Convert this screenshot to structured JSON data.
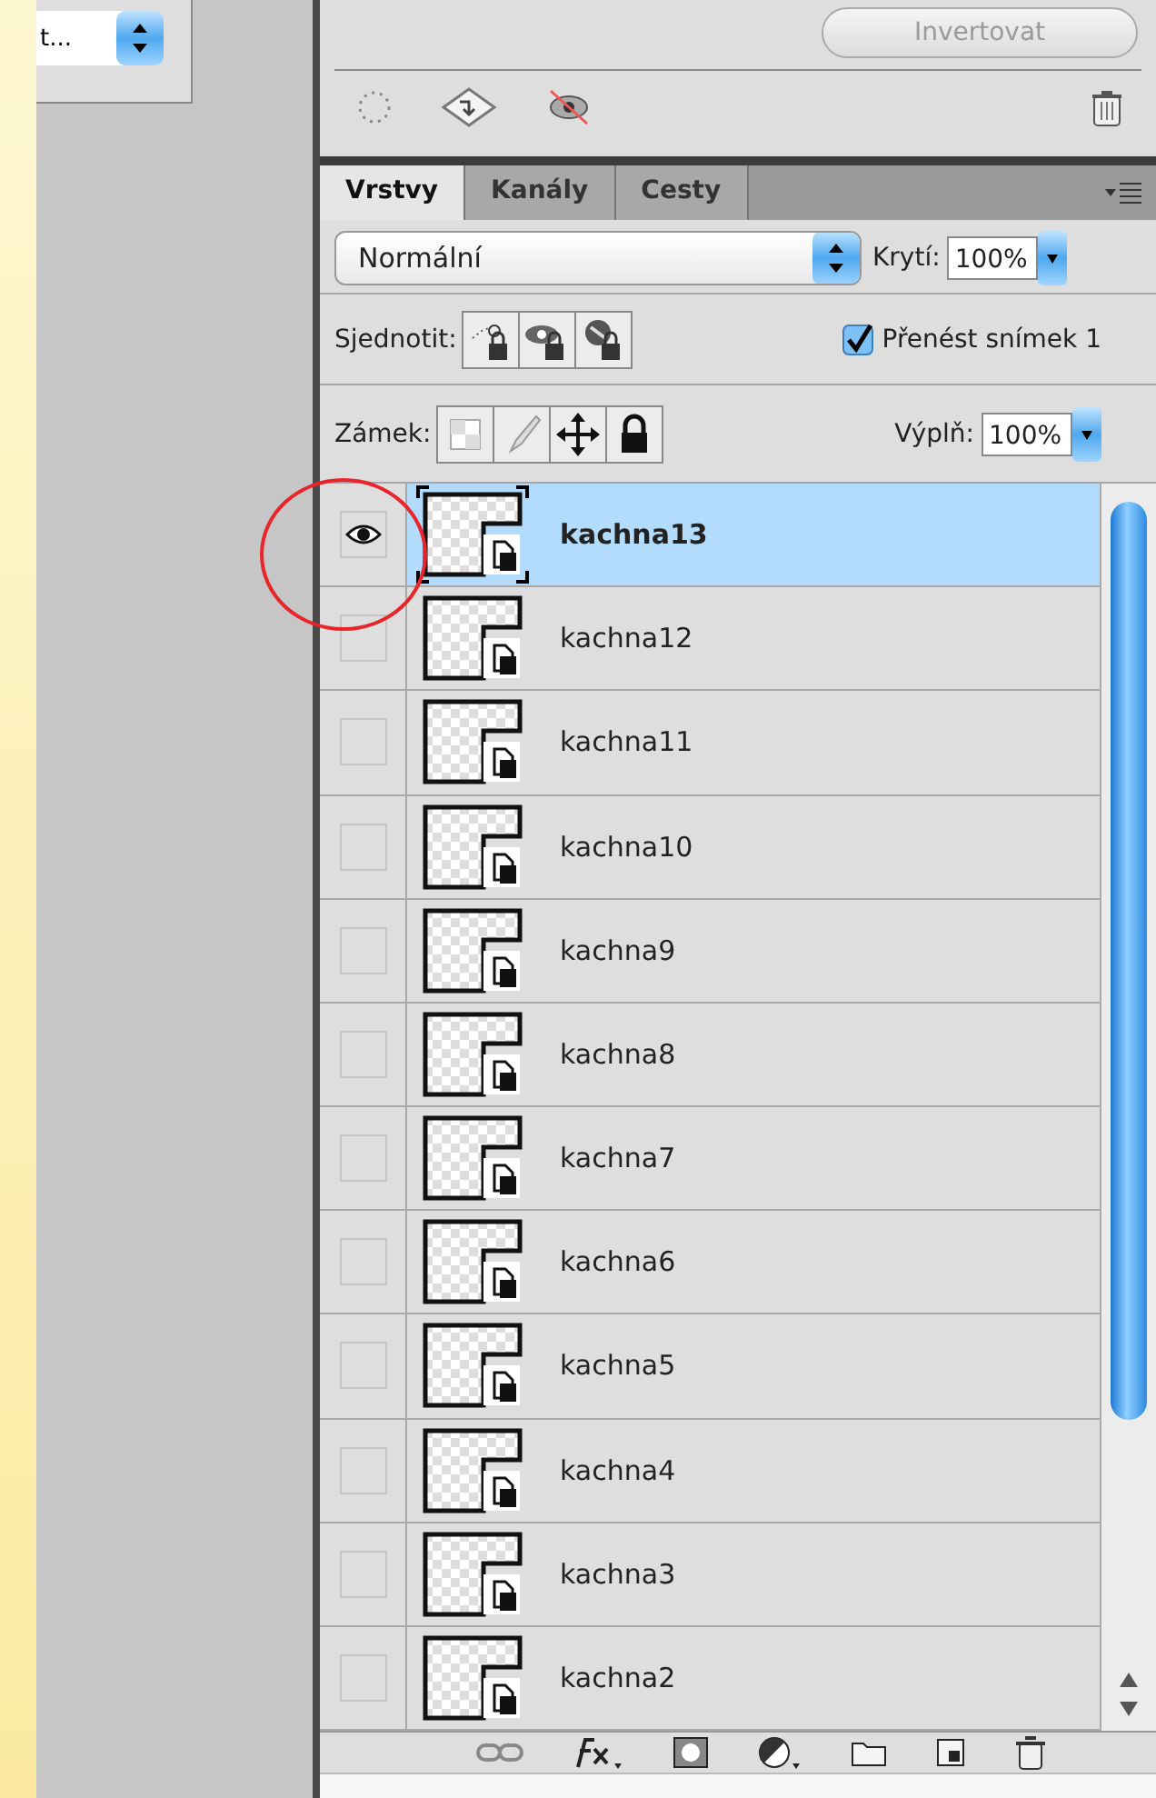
{
  "left_popup": {
    "value": "t..."
  },
  "mask_panel": {
    "invert_button": {
      "label": "Invertovat",
      "disabled": true
    }
  },
  "tabs": [
    {
      "label": "Vrstvy",
      "selected": true
    },
    {
      "label": "Kanály",
      "selected": false
    },
    {
      "label": "Cesty",
      "selected": false
    }
  ],
  "blend_mode": {
    "value": "Normální"
  },
  "opacity": {
    "label": "Krytí:",
    "value": "100%"
  },
  "unify": {
    "label": "Sjednotit:"
  },
  "propagate": {
    "label": "Přenést snímek 1",
    "checked": true
  },
  "lock": {
    "label": "Zámek:"
  },
  "fill": {
    "label": "Výplň:",
    "value": "100%"
  },
  "layers": [
    {
      "name": "kachna13",
      "visible": true,
      "selected": true
    },
    {
      "name": "kachna12",
      "visible": false,
      "selected": false
    },
    {
      "name": "kachna11",
      "visible": false,
      "selected": false
    },
    {
      "name": "kachna10",
      "visible": false,
      "selected": false
    },
    {
      "name": "kachna9",
      "visible": false,
      "selected": false
    },
    {
      "name": "kachna8",
      "visible": false,
      "selected": false
    },
    {
      "name": "kachna7",
      "visible": false,
      "selected": false
    },
    {
      "name": "kachna6",
      "visible": false,
      "selected": false
    },
    {
      "name": "kachna5",
      "visible": false,
      "selected": false
    },
    {
      "name": "kachna4",
      "visible": false,
      "selected": false
    },
    {
      "name": "kachna3",
      "visible": false,
      "selected": false
    },
    {
      "name": "kachna2",
      "visible": false,
      "selected": false
    }
  ]
}
